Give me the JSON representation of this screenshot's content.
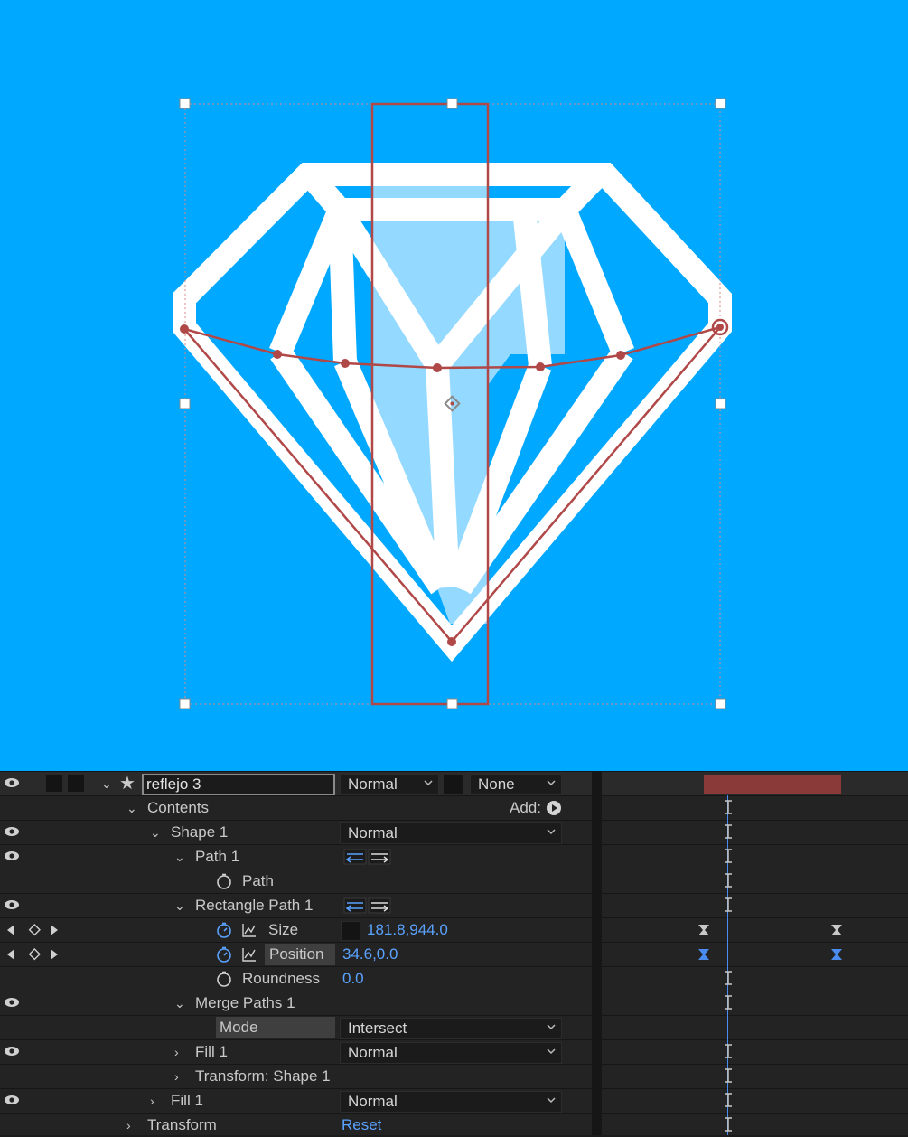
{
  "viewer": {
    "background": "#00a8ff",
    "diamond_stroke": "#ffffff",
    "reflection_color": "#aee2ff",
    "path_color": "#b04848"
  },
  "layer": {
    "name": "reflejo 3",
    "mode": "Normal",
    "track_matte": "None",
    "bar_color": "#8b3a3a"
  },
  "contents": {
    "label": "Contents",
    "add_label": "Add:"
  },
  "shape1": {
    "label": "Shape 1",
    "blend": "Normal"
  },
  "path1": {
    "label": "Path 1",
    "path_label": "Path"
  },
  "rect_path": {
    "label": "Rectangle Path 1",
    "size_label": "Size",
    "size_value": "181.8,944.0",
    "position_label": "Position",
    "position_value": "34.6,0.0",
    "roundness_label": "Roundness",
    "roundness_value": "0.0"
  },
  "merge_paths": {
    "label": "Merge Paths 1",
    "mode_label": "Mode",
    "mode_value": "Intersect"
  },
  "fill1": {
    "label": "Fill 1",
    "blend": "Normal"
  },
  "transform_shape1": {
    "label": "Transform: Shape 1"
  },
  "fill1_outer": {
    "label": "Fill 1",
    "blend": "Normal"
  },
  "transform": {
    "label": "Transform",
    "reset": "Reset"
  },
  "icons": [
    "eye-icon",
    "twirl-down-icon",
    "twirl-right-icon",
    "star-icon",
    "stopwatch-icon",
    "graph-icon",
    "keyframe-nav-icon",
    "dropdown-arrow-icon",
    "play-circle-icon",
    "path-direction-icon",
    "keyframe-icon",
    "playhead-icon"
  ]
}
